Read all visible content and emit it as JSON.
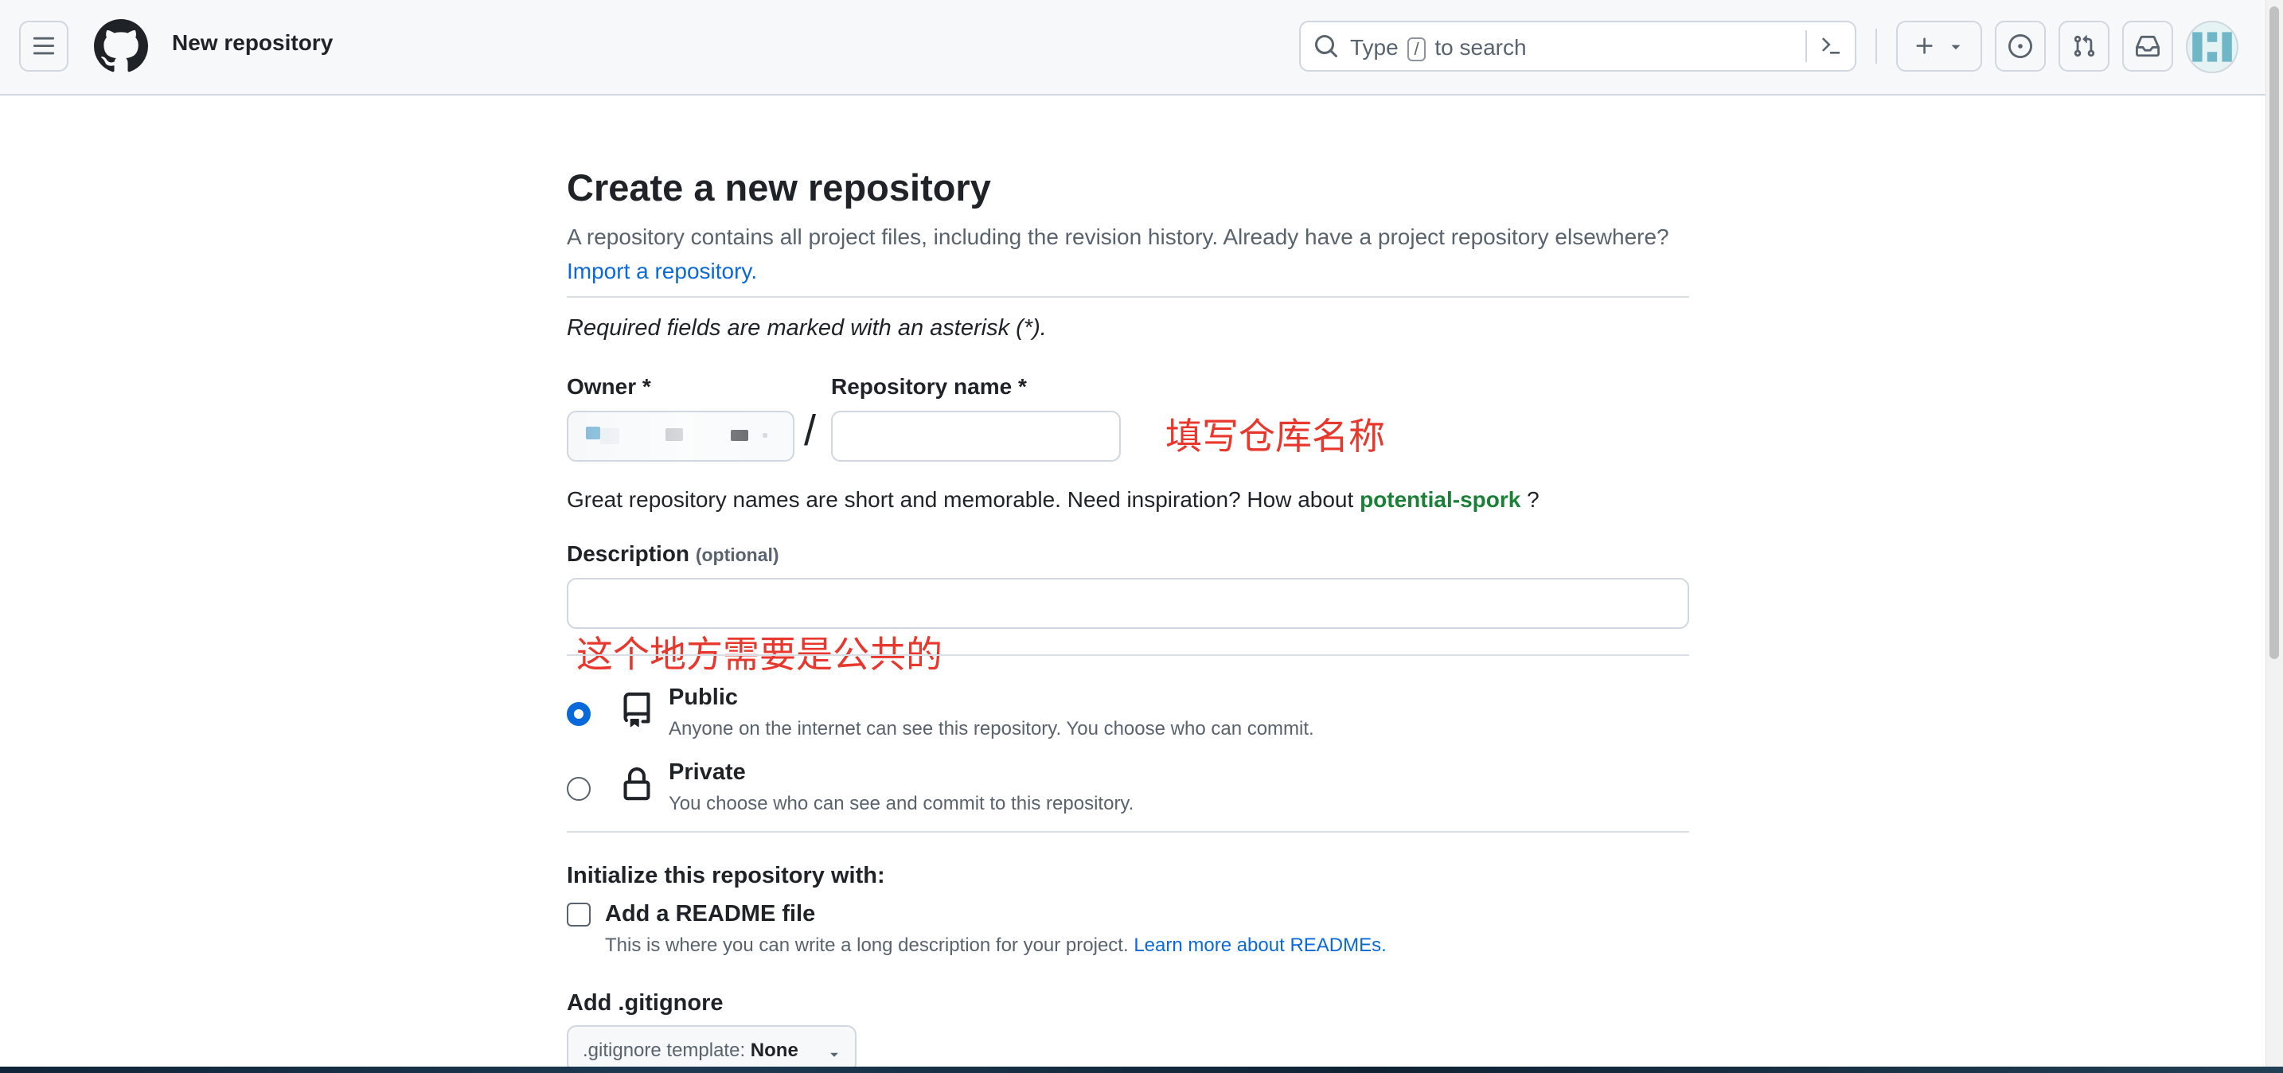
{
  "header": {
    "title": "New repository",
    "search": {
      "prefix": "Type",
      "key": "/",
      "suffix": "to search"
    }
  },
  "form": {
    "heading": "Create a new repository",
    "intro": "A repository contains all project files, including the revision history. Already have a project repository elsewhere?",
    "import_link": "Import a repository.",
    "required_note": "Required fields are marked with an asterisk (*).",
    "owner_label": "Owner *",
    "repo_name_label": "Repository name *",
    "repo_name_value": "",
    "separator": "/",
    "name_hint": "Great repository names are short and memorable. Need inspiration? How about",
    "name_suggestion": "potential-spork",
    "name_hint_end": "?",
    "description_label": "Description",
    "description_optional": "(optional)",
    "description_value": "",
    "visibility": [
      {
        "title": "Public",
        "description": "Anyone on the internet can see this repository. You choose who can commit.",
        "selected": true,
        "icon": "repo-icon"
      },
      {
        "title": "Private",
        "description": "You choose who can see and commit to this repository.",
        "selected": false,
        "icon": "lock-icon"
      }
    ],
    "init_label": "Initialize this repository with:",
    "readme_title": "Add a README file",
    "readme_desc": "This is where you can write a long description for your project.",
    "readme_link": "Learn more about READMEs.",
    "readme_checked": false,
    "gitignore_label": "Add .gitignore",
    "gitignore_prefix": ".gitignore template:",
    "gitignore_value": "None"
  },
  "annotations": {
    "repo_name": "填写仓库名称",
    "public": "这个地方需要是公共的"
  },
  "colors": {
    "accent": "#0969da",
    "annotation": "#e8372c",
    "suggestion": "#1a7f37"
  }
}
